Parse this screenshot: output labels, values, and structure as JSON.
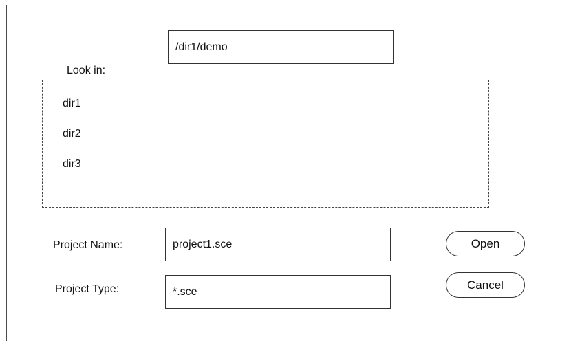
{
  "look_in": {
    "label": "Look in:",
    "path": "/dir1/demo"
  },
  "file_list": {
    "items": [
      "dir1",
      "dir2",
      "dir3"
    ]
  },
  "project_name": {
    "label": "Project Name:",
    "value": "project1.sce"
  },
  "project_type": {
    "label": "Project Type:",
    "value": "*.sce"
  },
  "buttons": {
    "open": "Open",
    "cancel": "Cancel"
  }
}
